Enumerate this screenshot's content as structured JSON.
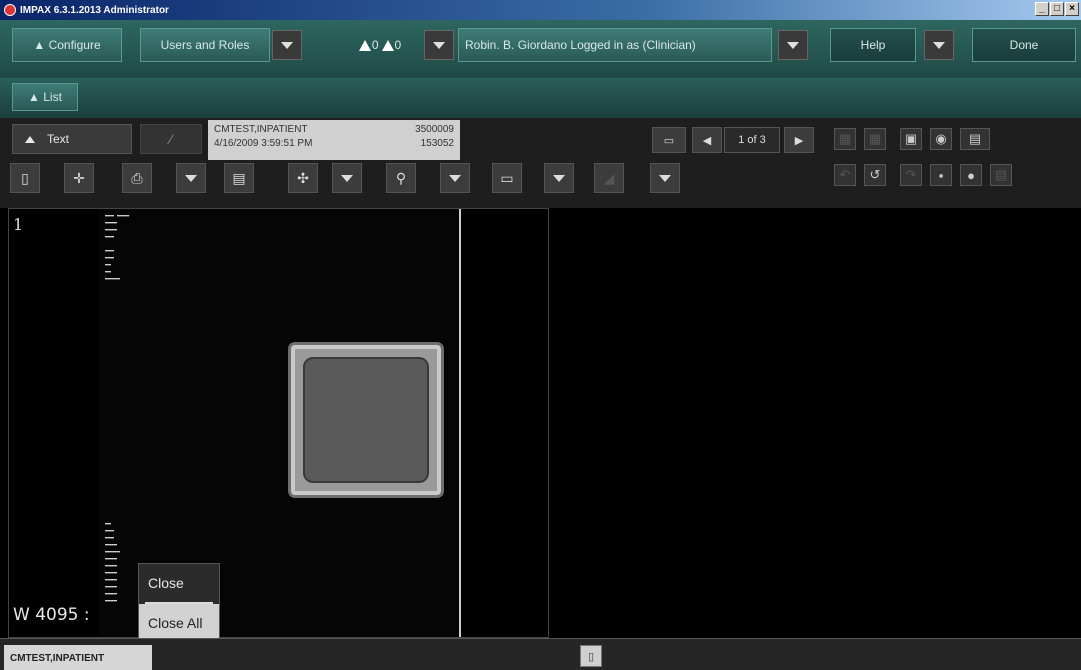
{
  "window": {
    "title": "IMPAX 6.3.1.2013 Administrator"
  },
  "topbar": {
    "configure": "▲ Configure",
    "users_roles": "Users and Roles",
    "warnings": [
      "0",
      "0"
    ],
    "user_status": "Robin. B. Giordano Logged in as (Clinician)",
    "help": "Help",
    "done": "Done"
  },
  "listbar": {
    "list": "▲ List"
  },
  "toolbar": {
    "text_label": "Text",
    "patient_name": "CMTEST,INPATIENT",
    "patient_id": "3500009",
    "study_datetime": "4/16/2009 3:59:51 PM",
    "accession": "153052",
    "page_indicator": "1 of 3"
  },
  "viewer": {
    "slot_number": "1",
    "window_level": "W 4095 :"
  },
  "context_menu": {
    "items": [
      "Close",
      "Close All"
    ]
  },
  "statusbar": {
    "patient_tab": "CMTEST,INPATIENT"
  },
  "colors": {
    "teal": "#2e6660",
    "teal_dark": "#1f4a46",
    "menu_highlight": "#d2d2d2"
  }
}
